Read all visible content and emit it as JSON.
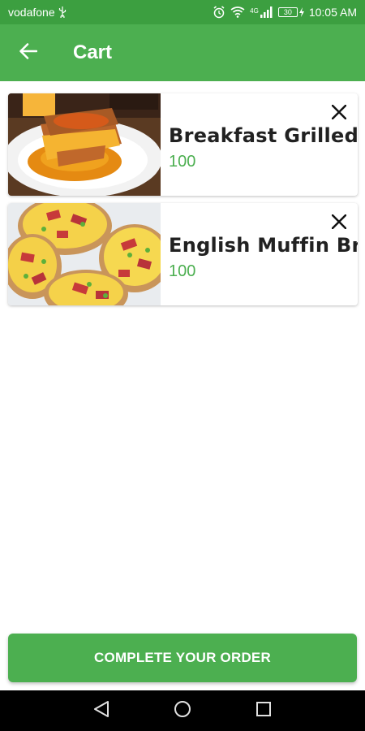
{
  "status_bar": {
    "carrier": "vodafone",
    "usb_icon": "usb-icon",
    "alarm_icon": "alarm-icon",
    "wifi_icon": "wifi-icon",
    "network_type": "4G",
    "signal_icon": "signal-icon",
    "battery_level": "30",
    "charging_icon": "charging-icon",
    "time": "10:05 AM"
  },
  "app_bar": {
    "back_icon": "back-arrow-icon",
    "title": "Cart"
  },
  "cart": {
    "items": [
      {
        "name": "Breakfast Grilled Cheese",
        "price": "100",
        "image": "grilled-cheese-photo",
        "remove_icon": "close-icon"
      },
      {
        "name": "English Muffin Breakfast",
        "price": "100",
        "image": "english-muffin-photo",
        "remove_icon": "close-icon"
      }
    ]
  },
  "order_button": {
    "label": "COMPLETE YOUR ORDER"
  },
  "nav_bar": {
    "back_icon": "nav-back-icon",
    "home_icon": "nav-home-icon",
    "recents_icon": "nav-recents-icon"
  },
  "colors": {
    "status_bar": "#3c9f40",
    "primary": "#4caf50",
    "price_text": "#4caf50",
    "title_text": "#212121",
    "nav_bar": "#000000"
  }
}
